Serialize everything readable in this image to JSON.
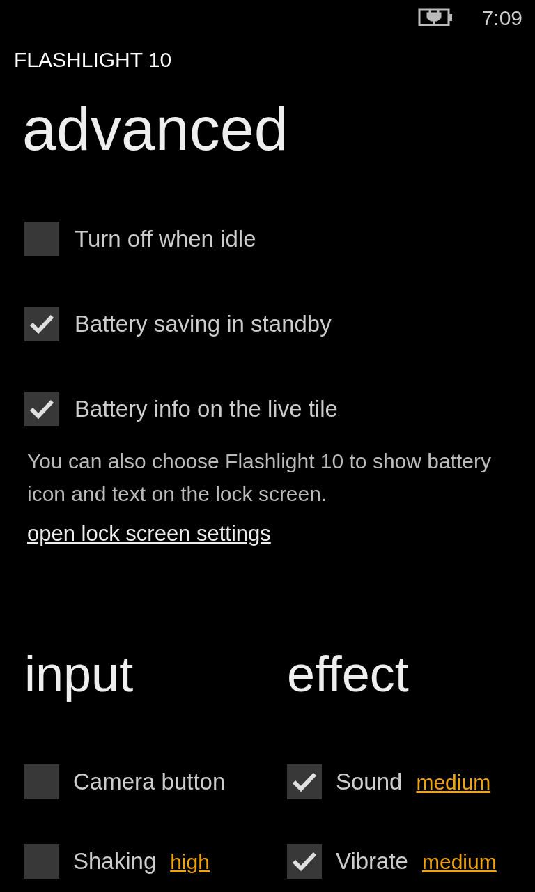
{
  "status_bar": {
    "time": "7:09"
  },
  "app_title": "FLASHLIGHT 10",
  "page_title": "advanced",
  "options": [
    {
      "label": "Turn off when idle",
      "checked": false
    },
    {
      "label": "Battery saving in standby",
      "checked": true
    },
    {
      "label": "Battery info on the live tile",
      "checked": true
    }
  ],
  "description": "You can also choose Flashlight 10 to show battery icon and text on the lock screen.",
  "link": "open lock screen settings",
  "sections": [
    {
      "title": "input",
      "options": [
        {
          "label": "Camera button",
          "checked": false
        },
        {
          "label": "Shaking",
          "checked": false,
          "setting": "high"
        }
      ]
    },
    {
      "title": "effect",
      "options": [
        {
          "label": "Sound",
          "checked": true,
          "setting": "medium"
        },
        {
          "label": "Vibrate",
          "checked": true,
          "setting": "medium"
        }
      ]
    }
  ]
}
